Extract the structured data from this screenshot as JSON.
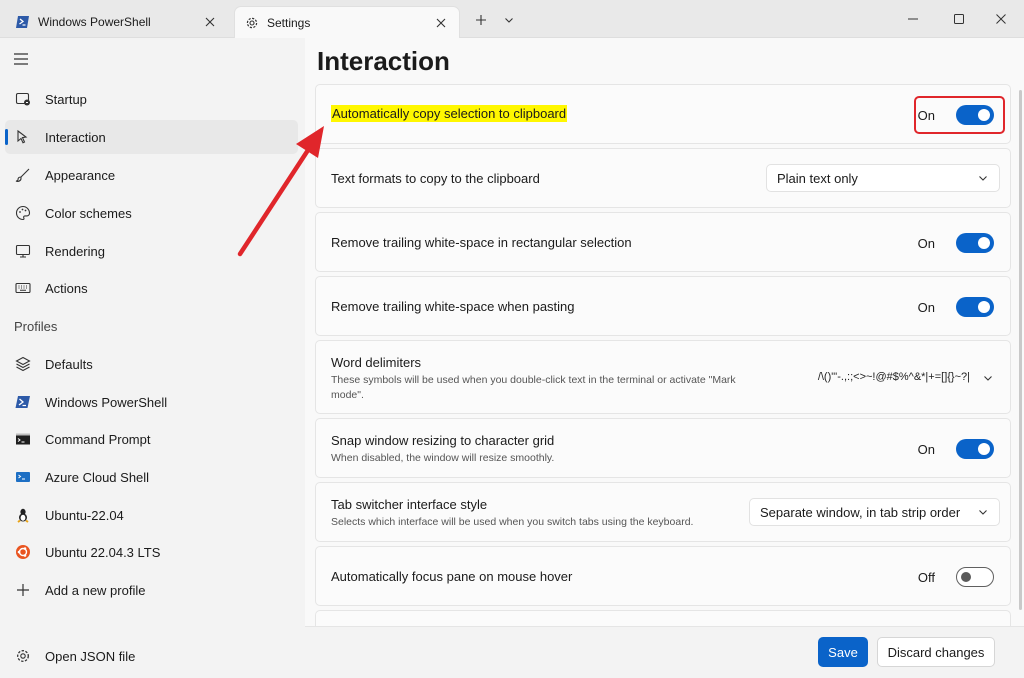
{
  "tabs": [
    {
      "label": "Windows PowerShell"
    },
    {
      "label": "Settings"
    }
  ],
  "sidebar": {
    "items": [
      {
        "label": "Startup",
        "icon": "startup-icon"
      },
      {
        "label": "Interaction",
        "icon": "cursor-icon",
        "selected": true
      },
      {
        "label": "Appearance",
        "icon": "brush-icon"
      },
      {
        "label": "Color schemes",
        "icon": "palette-icon"
      },
      {
        "label": "Rendering",
        "icon": "monitor-icon"
      },
      {
        "label": "Actions",
        "icon": "keyboard-icon"
      }
    ],
    "profiles_label": "Profiles",
    "profiles": [
      {
        "label": "Defaults",
        "icon": "layers-icon"
      },
      {
        "label": "Windows PowerShell",
        "icon": "powershell-icon"
      },
      {
        "label": "Command Prompt",
        "icon": "cmd-icon"
      },
      {
        "label": "Azure Cloud Shell",
        "icon": "azure-icon"
      },
      {
        "label": "Ubuntu-22.04",
        "icon": "linux-icon"
      },
      {
        "label": "Ubuntu 22.04.3 LTS",
        "icon": "ubuntu-icon"
      },
      {
        "label": "Add a new profile",
        "icon": "plus-icon"
      }
    ],
    "open_json": "Open JSON file"
  },
  "main": {
    "title": "Interaction",
    "settings": {
      "copy_on_select": {
        "title": "Automatically copy selection to clipboard",
        "state": "On"
      },
      "text_formats": {
        "title": "Text formats to copy to the clipboard",
        "value": "Plain text only"
      },
      "trim_rect": {
        "title": "Remove trailing white-space in rectangular selection",
        "state": "On"
      },
      "trim_paste": {
        "title": "Remove trailing white-space when pasting",
        "state": "On"
      },
      "word_delimiters": {
        "title": "Word delimiters",
        "subtitle": "These symbols will be used when you double-click text in the terminal or activate \"Mark mode\".",
        "value": "/\\()\"'-.,:;<>~!@#$%^&*|+=[]{}~?|"
      },
      "snap_resize": {
        "title": "Snap window resizing to character grid",
        "subtitle": "When disabled, the window will resize smoothly.",
        "state": "On"
      },
      "tab_switcher": {
        "title": "Tab switcher interface style",
        "subtitle": "Selects which interface will be used when you switch tabs using the keyboard.",
        "value": "Separate window, in tab strip order"
      },
      "focus_follow_mouse": {
        "title": "Automatically focus pane on mouse hover",
        "state": "Off"
      }
    }
  },
  "footer": {
    "save": "Save",
    "discard": "Discard changes"
  },
  "colors": {
    "accent": "#0a63c9",
    "highlight": "#fff700",
    "annotation_red": "#e0262b"
  }
}
